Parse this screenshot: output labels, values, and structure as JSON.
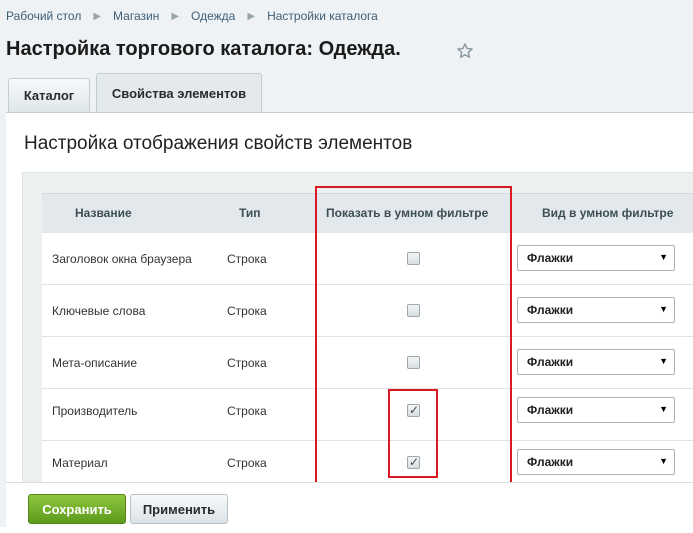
{
  "breadcrumb": [
    "Рабочий стол",
    "Магазин",
    "Одежда",
    "Настройки каталога"
  ],
  "page": {
    "title": "Настройка торгового каталога: Одежда."
  },
  "tabs": [
    {
      "label": "Каталог",
      "active": false
    },
    {
      "label": "Свойства элементов",
      "active": true
    }
  ],
  "section": {
    "title": "Настройка отображения свойств элементов"
  },
  "table": {
    "headers": [
      "Название",
      "Тип",
      "Показать в умном фильтре",
      "Вид в умном фильтре"
    ],
    "rows": [
      {
        "name": "Заголовок окна браузера",
        "type": "Строка",
        "show_in_smart_filter": false,
        "view": "Флажки"
      },
      {
        "name": "Ключевые слова",
        "type": "Строка",
        "show_in_smart_filter": false,
        "view": "Флажки"
      },
      {
        "name": "Мета-описание",
        "type": "Строка",
        "show_in_smart_filter": false,
        "view": "Флажки"
      },
      {
        "name": "Производитель",
        "type": "Строка",
        "show_in_smart_filter": true,
        "view": "Флажки"
      },
      {
        "name": "Материал",
        "type": "Строка",
        "show_in_smart_filter": true,
        "view": "Флажки"
      }
    ]
  },
  "buttons": {
    "save": "Сохранить",
    "apply": "Применить"
  },
  "colors": {
    "highlight": "#d8191f",
    "save_button": "#6fae27"
  }
}
